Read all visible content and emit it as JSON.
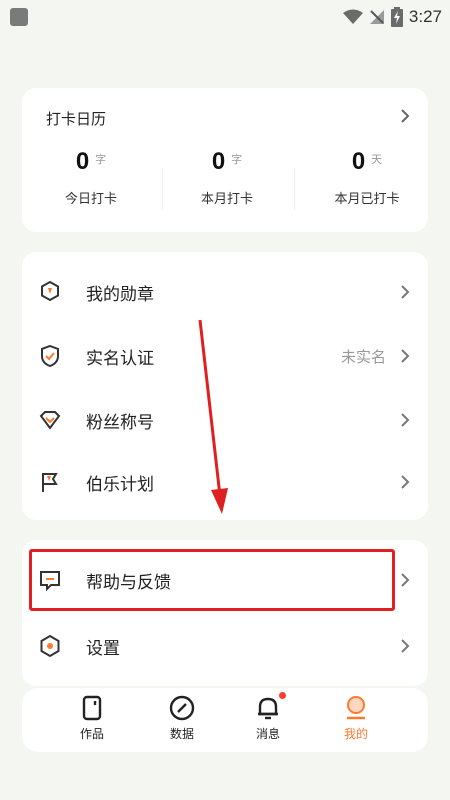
{
  "status_bar": {
    "time": "3:27",
    "icons": [
      "wifi-icon",
      "no-signal-icon",
      "battery-charging-icon"
    ]
  },
  "checkin": {
    "title": "打卡日历",
    "stats": [
      {
        "value": "0",
        "unit": "字",
        "label": "今日打卡"
      },
      {
        "value": "0",
        "unit": "字",
        "label": "本月打卡"
      },
      {
        "value": "0",
        "unit": "天",
        "label": "本月已打卡"
      }
    ]
  },
  "menu_group_1": [
    {
      "label": "我的勋章",
      "icon": "medal-icon"
    },
    {
      "label": "实名认证",
      "icon": "shield-check-icon",
      "value": "未实名"
    },
    {
      "label": "粉丝称号",
      "icon": "diamond-badge-icon"
    },
    {
      "label": "伯乐计划",
      "icon": "flag-icon"
    }
  ],
  "menu_group_2": [
    {
      "label": "帮助与反馈",
      "icon": "feedback-icon"
    },
    {
      "label": "设置",
      "icon": "settings-icon"
    }
  ],
  "bottom_nav": [
    {
      "label": "作品",
      "icon": "works-icon"
    },
    {
      "label": "数据",
      "icon": "data-icon"
    },
    {
      "label": "消息",
      "icon": "bell-icon",
      "badge": true
    },
    {
      "label": "我的",
      "icon": "profile-icon",
      "active": true
    }
  ],
  "colors": {
    "accent": "#ff7a2f",
    "annotation_red": "#e02020",
    "background": "#f3f6f1"
  }
}
